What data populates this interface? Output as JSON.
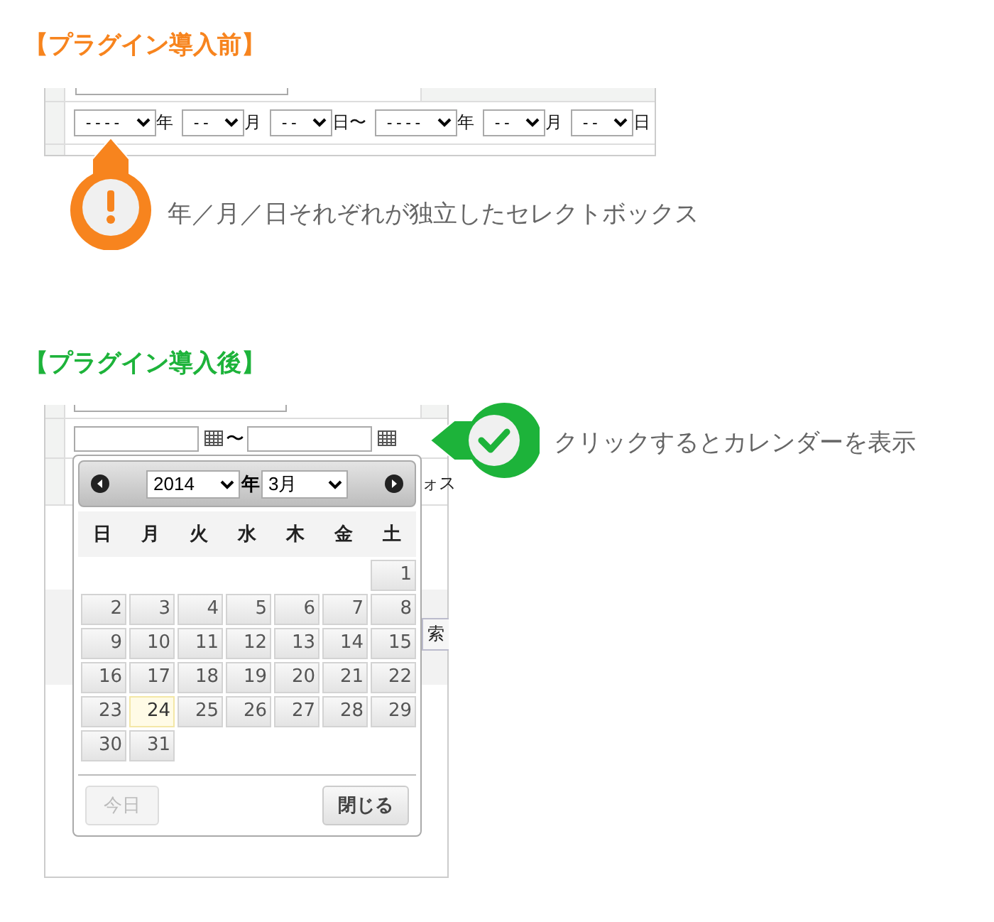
{
  "before": {
    "heading": "【プラグイン導入前】",
    "selects": [
      {
        "value": "----",
        "suffix": "年",
        "kind": "year"
      },
      {
        "value": "--",
        "suffix": "月",
        "kind": "short"
      },
      {
        "value": "--",
        "suffix": "日〜",
        "kind": "short"
      },
      {
        "value": "----",
        "suffix": "年",
        "kind": "year"
      },
      {
        "value": "--",
        "suffix": "月",
        "kind": "short"
      },
      {
        "value": "--",
        "suffix": "日",
        "kind": "short"
      }
    ],
    "callout": "年／月／日それぞれが独立したセレクトボックス"
  },
  "after": {
    "heading": "【プラグイン導入後】",
    "range_separator": "〜",
    "hidden_fragments": [
      "ォス",
      "索"
    ],
    "calendar": {
      "year": "2014",
      "year_suffix": "年",
      "month": "3月",
      "weekdays": [
        "日",
        "月",
        "火",
        "水",
        "木",
        "金",
        "土"
      ],
      "weeks": [
        [
          {
            "kind": "empty"
          },
          {
            "kind": "empty"
          },
          {
            "kind": "empty"
          },
          {
            "kind": "empty"
          },
          {
            "kind": "empty"
          },
          {
            "kind": "empty"
          },
          {
            "kind": "day",
            "label": "1",
            "today": false
          }
        ],
        [
          {
            "kind": "day",
            "label": "2",
            "today": false
          },
          {
            "kind": "day",
            "label": "3",
            "today": false
          },
          {
            "kind": "day",
            "label": "4",
            "today": false
          },
          {
            "kind": "day",
            "label": "5",
            "today": false
          },
          {
            "kind": "day",
            "label": "6",
            "today": false
          },
          {
            "kind": "day",
            "label": "7",
            "today": false
          },
          {
            "kind": "day",
            "label": "8",
            "today": false
          }
        ],
        [
          {
            "kind": "day",
            "label": "9",
            "today": false
          },
          {
            "kind": "day",
            "label": "10",
            "today": false
          },
          {
            "kind": "day",
            "label": "11",
            "today": false
          },
          {
            "kind": "day",
            "label": "12",
            "today": false
          },
          {
            "kind": "day",
            "label": "13",
            "today": false
          },
          {
            "kind": "day",
            "label": "14",
            "today": false
          },
          {
            "kind": "day",
            "label": "15",
            "today": false
          }
        ],
        [
          {
            "kind": "day",
            "label": "16",
            "today": false
          },
          {
            "kind": "day",
            "label": "17",
            "today": false
          },
          {
            "kind": "day",
            "label": "18",
            "today": false
          },
          {
            "kind": "day",
            "label": "19",
            "today": false
          },
          {
            "kind": "day",
            "label": "20",
            "today": false
          },
          {
            "kind": "day",
            "label": "21",
            "today": false
          },
          {
            "kind": "day",
            "label": "22",
            "today": false
          }
        ],
        [
          {
            "kind": "day",
            "label": "23",
            "today": false
          },
          {
            "kind": "day",
            "label": "24",
            "today": true
          },
          {
            "kind": "day",
            "label": "25",
            "today": false
          },
          {
            "kind": "day",
            "label": "26",
            "today": false
          },
          {
            "kind": "day",
            "label": "27",
            "today": false
          },
          {
            "kind": "day",
            "label": "28",
            "today": false
          },
          {
            "kind": "day",
            "label": "29",
            "today": false
          }
        ],
        [
          {
            "kind": "day",
            "label": "30",
            "today": false
          },
          {
            "kind": "day",
            "label": "31",
            "today": false
          },
          {
            "kind": "empty"
          },
          {
            "kind": "empty"
          },
          {
            "kind": "empty"
          },
          {
            "kind": "empty"
          },
          {
            "kind": "empty"
          }
        ]
      ],
      "buttons": [
        {
          "label": "今日",
          "disabled": true
        },
        {
          "label": "閉じる",
          "disabled": false
        }
      ]
    },
    "callout": "クリックするとカレンダーを表示"
  }
}
